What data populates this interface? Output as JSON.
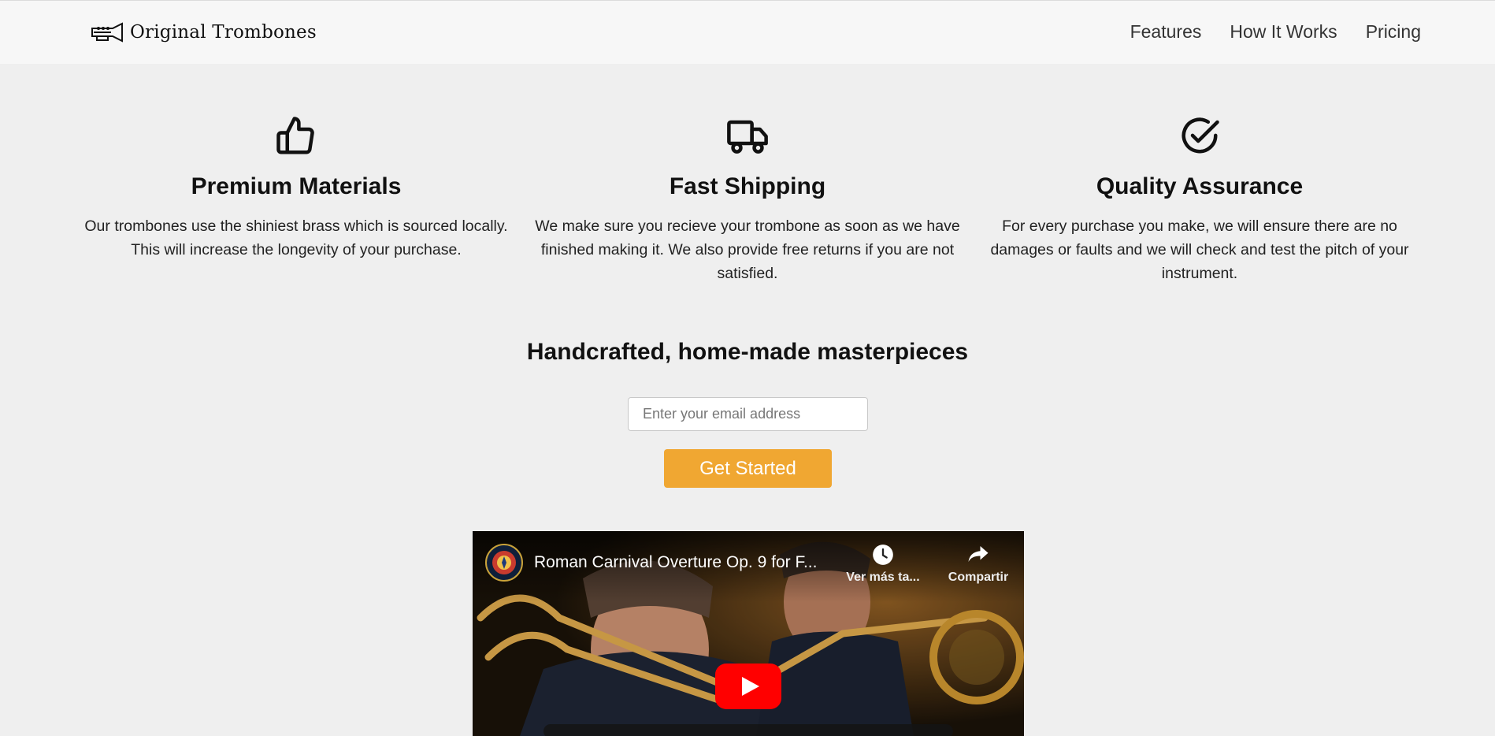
{
  "header": {
    "brand": "Original Trombones",
    "logo_icon": "trombone-logo-icon",
    "nav": [
      {
        "label": "Features"
      },
      {
        "label": "How It Works"
      },
      {
        "label": "Pricing"
      }
    ]
  },
  "features": [
    {
      "icon": "thumbs-up-icon",
      "title": "Premium Materials",
      "text": "Our trombones use the shiniest brass which is sourced locally. This will increase the longevity of your purchase."
    },
    {
      "icon": "truck-icon",
      "title": "Fast Shipping",
      "text": "We make sure you recieve your trombone as soon as we have finished making it. We also provide free returns if you are not satisfied."
    },
    {
      "icon": "check-circle-icon",
      "title": "Quality Assurance",
      "text": "For every purchase you make, we will ensure there are no damages or faults and we will check and test the pitch of your instrument."
    }
  ],
  "hero": {
    "title": "Handcrafted, home-made masterpieces",
    "email_placeholder": "Enter your email address",
    "email_value": "",
    "cta_label": "Get Started"
  },
  "video": {
    "title": "Roman Carnival Overture Op. 9 for F...",
    "watch_later_label": "Ver más ta...",
    "share_label": "Compartir"
  },
  "colors": {
    "page_bg": "#efefef",
    "header_bg": "#f7f7f7",
    "cta_bg": "#f0a732",
    "youtube_red": "#ff0000"
  }
}
